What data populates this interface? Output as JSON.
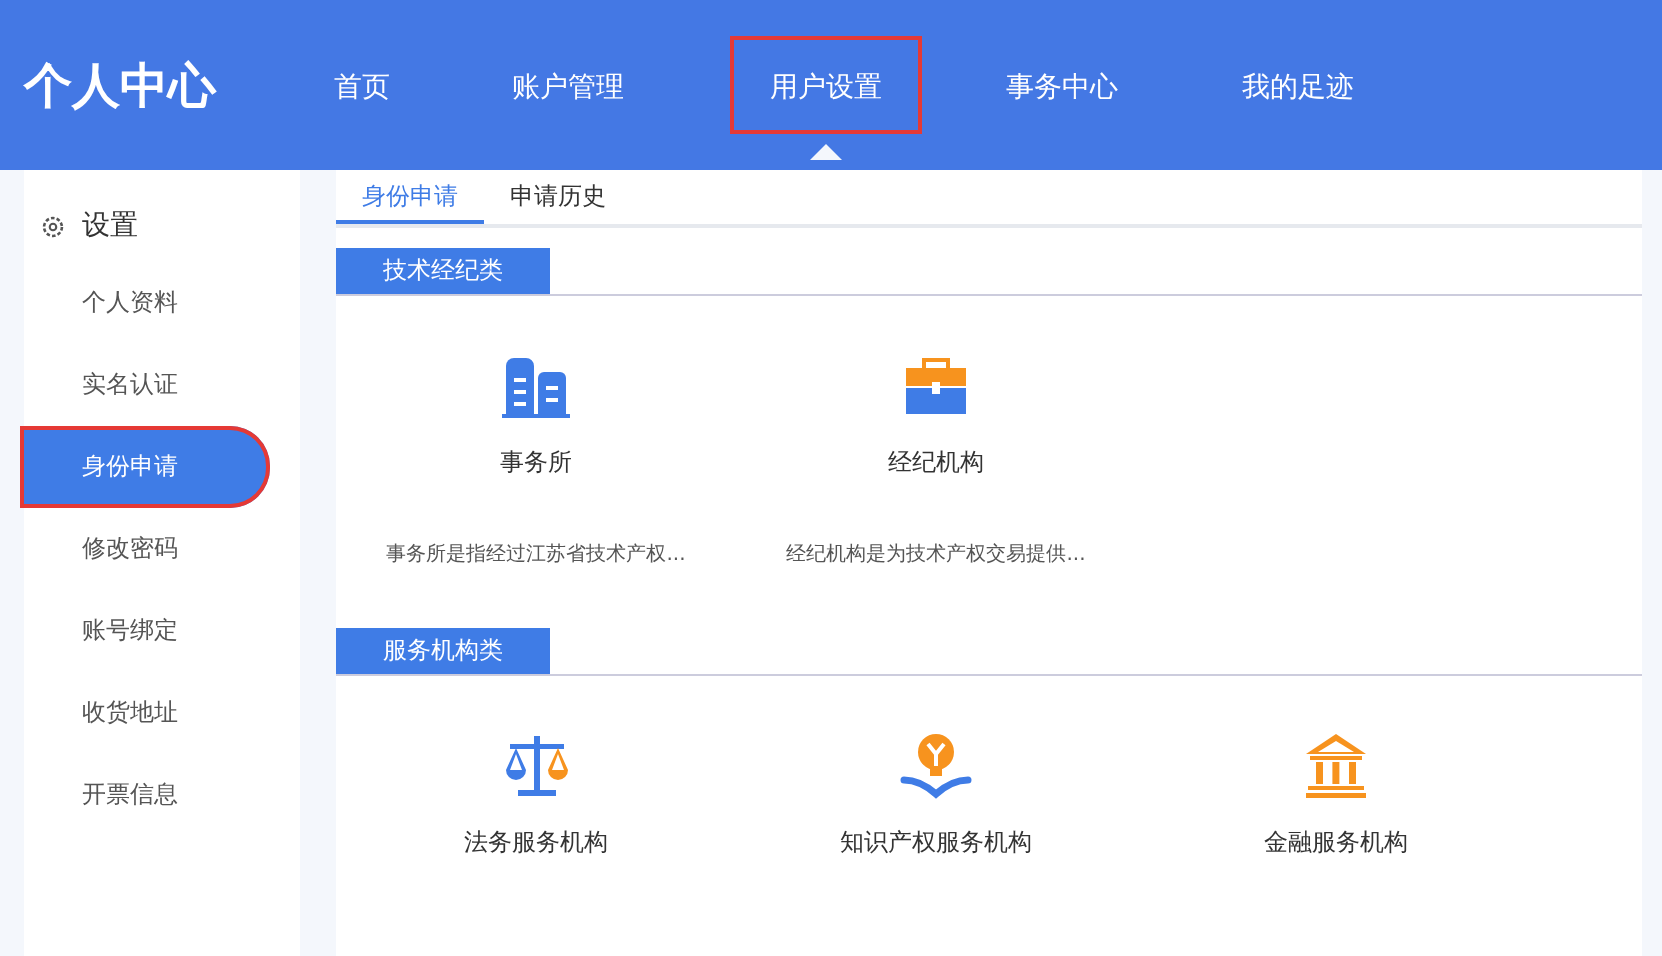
{
  "header": {
    "title": "个人中心",
    "nav": [
      {
        "label": "首页",
        "selected": false,
        "highlighted": false
      },
      {
        "label": "账户管理",
        "selected": false,
        "highlighted": false
      },
      {
        "label": "用户设置",
        "selected": true,
        "highlighted": true
      },
      {
        "label": "事务中心",
        "selected": false,
        "highlighted": false
      },
      {
        "label": "我的足迹",
        "selected": false,
        "highlighted": false
      }
    ]
  },
  "sidebar": {
    "heading": "设置",
    "items": [
      {
        "label": "个人资料",
        "selected": false,
        "highlighted": false
      },
      {
        "label": "实名认证",
        "selected": false,
        "highlighted": false
      },
      {
        "label": "身份申请",
        "selected": true,
        "highlighted": true
      },
      {
        "label": "修改密码",
        "selected": false,
        "highlighted": false
      },
      {
        "label": "账号绑定",
        "selected": false,
        "highlighted": false
      },
      {
        "label": "收货地址",
        "selected": false,
        "highlighted": false
      },
      {
        "label": "开票信息",
        "selected": false,
        "highlighted": false
      }
    ]
  },
  "tabs": [
    {
      "label": "身份申请",
      "selected": true
    },
    {
      "label": "申请历史",
      "selected": false
    }
  ],
  "sections": [
    {
      "title": "技术经纪类",
      "items": [
        {
          "kind": "building",
          "name": "事务所",
          "description": "事务所是指经过江苏省技术产权..."
        },
        {
          "kind": "toolbox",
          "name": "经纪机构",
          "description": "经纪机构是为技术产权交易提供..."
        }
      ]
    },
    {
      "title": "服务机构类",
      "items": [
        {
          "kind": "scale",
          "name": "法务服务机构"
        },
        {
          "kind": "bulb",
          "name": "知识产权服务机构"
        },
        {
          "kind": "bank",
          "name": "金融服务机构"
        }
      ]
    }
  ]
}
